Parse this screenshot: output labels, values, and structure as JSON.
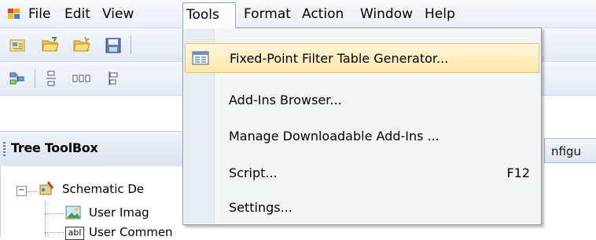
{
  "menubar": {
    "app_icon": "app-logo-icon",
    "items": [
      {
        "label": "File"
      },
      {
        "label": "Edit"
      },
      {
        "label": "View"
      },
      {
        "label": "Tools"
      },
      {
        "label": "Format"
      },
      {
        "label": "Action"
      },
      {
        "label": "Window"
      },
      {
        "label": "Help"
      }
    ],
    "active": "Tools"
  },
  "toolbar1": {
    "icons": [
      "new-schematic-icon",
      "open-folder-icon",
      "open-recent-icon",
      "save-icon"
    ]
  },
  "toolbar2": {
    "icons": [
      "layout-icon",
      "align-vertical-icon",
      "distribute-horizontal-icon",
      "align-left-icon"
    ]
  },
  "toolbox": {
    "title": "Tree ToolBox",
    "tree": [
      {
        "label": "Schematic De",
        "icon": "schematic-folder-icon",
        "expand": "⊟"
      },
      {
        "label": "User Imag",
        "icon": "image-icon"
      },
      {
        "label": "User Commen",
        "icon": "text-label-icon",
        "icon_text": "abl"
      }
    ]
  },
  "right_panel": {
    "tab_label": "nfigu",
    "icon": "toolbar-overflow-icon"
  },
  "tools_menu": {
    "items": [
      {
        "label": "Fixed-Point Filter Table Generator...",
        "shortcut": "",
        "icon": "table-generator-icon",
        "highlighted": true
      },
      {
        "label": "Add-Ins Browser...",
        "shortcut": ""
      },
      {
        "label": "Manage Downloadable Add-Ins ...",
        "shortcut": ""
      },
      {
        "label": "Script...",
        "shortcut": "F12"
      },
      {
        "label": "Settings...",
        "shortcut": ""
      }
    ]
  },
  "colors": {
    "highlight_bg": "#ffe8a6",
    "highlight_border": "#e5c365",
    "menu_border": "#979797"
  }
}
